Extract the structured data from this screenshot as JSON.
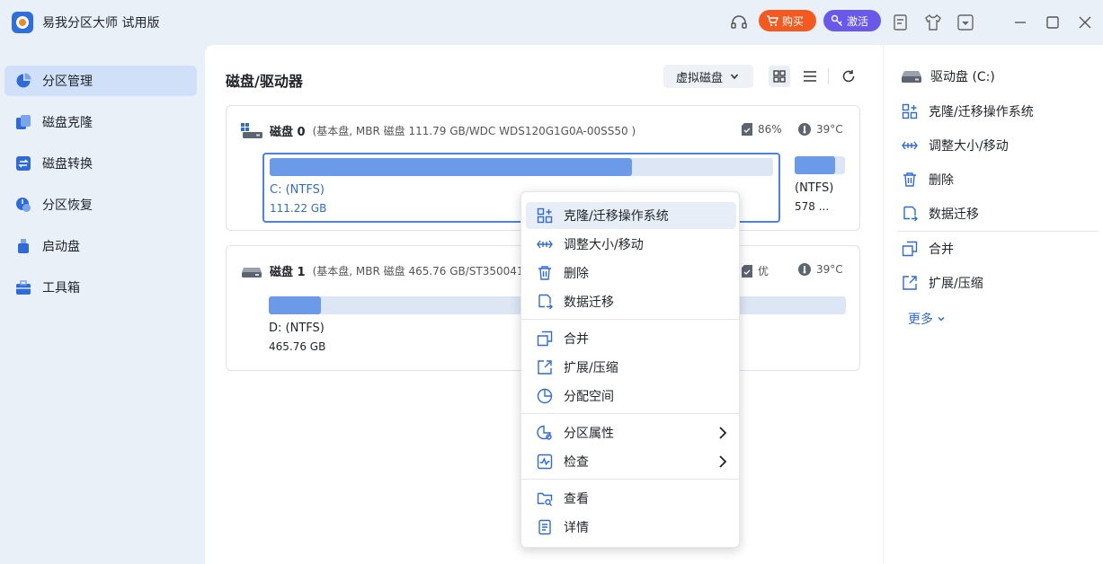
{
  "app": {
    "title": "易我分区大师 试用版"
  },
  "titlebar": {
    "buy_label": "购买",
    "activate_label": "激活"
  },
  "sidebar": {
    "items": [
      {
        "label": "分区管理",
        "icon": "pie-chart-icon",
        "active": true
      },
      {
        "label": "磁盘克隆",
        "icon": "clone-icon"
      },
      {
        "label": "磁盘转换",
        "icon": "convert-icon"
      },
      {
        "label": "分区恢复",
        "icon": "recover-icon"
      },
      {
        "label": "启动盘",
        "icon": "usb-icon"
      },
      {
        "label": "工具箱",
        "icon": "toolbox-icon"
      }
    ]
  },
  "main": {
    "title": "磁盘/驱动器",
    "view_select": "虚拟磁盘",
    "disks": [
      {
        "name": "磁盘 0",
        "info": "(基本盘, MBR 磁盘 111.79 GB/WDC WDS120G1G0A-00SS50 )",
        "health": "86%",
        "temp": "39°C",
        "partitions": [
          {
            "label": "C: (NTFS)",
            "size": "111.22 GB",
            "used": 0.72
          },
          {
            "label": "(NTFS)",
            "size": "578 ...",
            "used": 0.8
          }
        ]
      },
      {
        "name": "磁盘 1",
        "info": "(基本盘, MBR 磁盘 465.76 GB/ST3500410",
        "health": "优",
        "temp": "39°C",
        "partitions": [
          {
            "label": "D: (NTFS)",
            "size": "465.76 GB",
            "used": 0.09
          }
        ]
      }
    ]
  },
  "right_panel": {
    "drive": "驱动盘 (C:)",
    "actions": [
      "克隆/迁移操作系统",
      "调整大小/移动",
      "删除",
      "数据迁移",
      "合并",
      "扩展/压缩"
    ],
    "more": "更多"
  },
  "context_menu": {
    "items": [
      "克隆/迁移操作系统",
      "调整大小/移动",
      "删除",
      "数据迁移",
      "合并",
      "扩展/压缩",
      "分配空间",
      "分区属性",
      "检查",
      "查看",
      "详情"
    ]
  },
  "colors": {
    "accent": "#2f6ad9",
    "bar_fill": "#6b9be8",
    "bar_bg": "#dde6f4",
    "buy": "#f45a1f",
    "activate": "#6a58ea"
  }
}
